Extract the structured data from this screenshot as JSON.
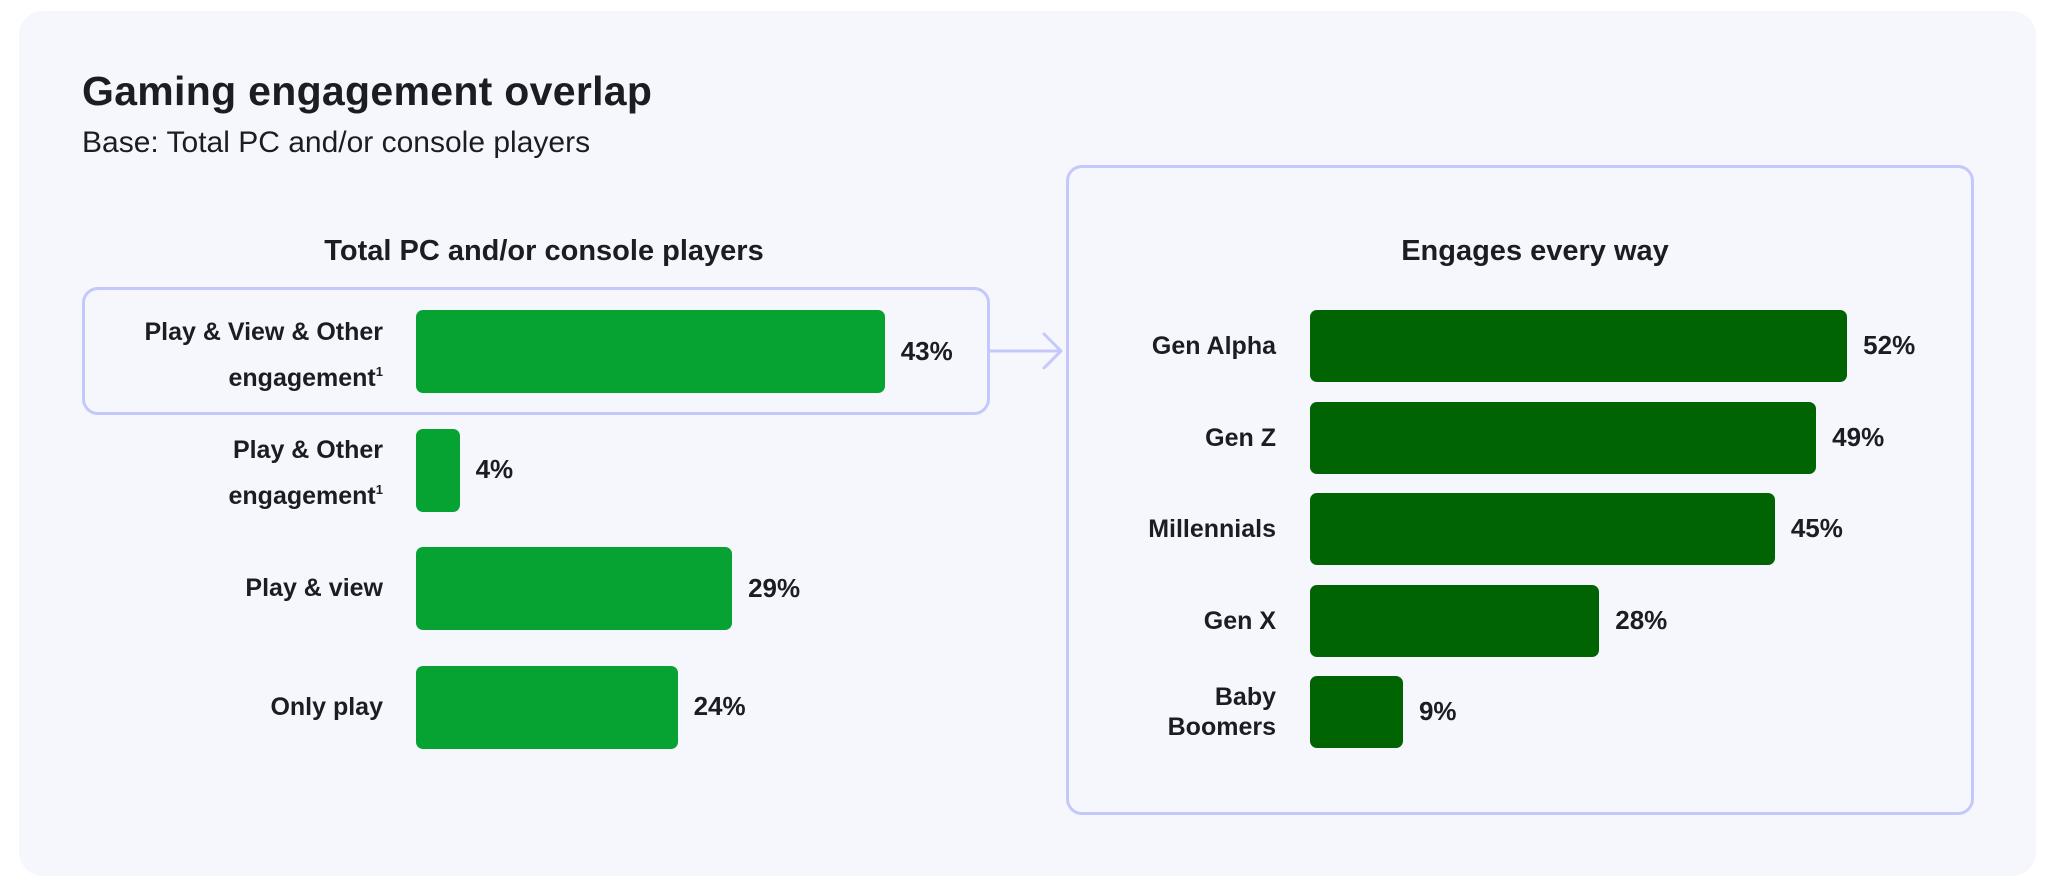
{
  "header": {
    "title": "Gaming engagement overlap",
    "subtitle": "Base: Total PC and/or console players"
  },
  "colors": {
    "background": "#f6f7fd",
    "left_bar": "#07a332",
    "right_bar": "#016402",
    "outline": "#c5c8fb",
    "text": "#1c1d22"
  },
  "icons": {
    "connector": "arrow-right-icon"
  },
  "chart_data": [
    {
      "type": "bar",
      "orientation": "horizontal",
      "title": "Total PC and/or console players",
      "categories": [
        {
          "lines": [
            "Play & View & Other",
            "engagement"
          ],
          "footnote": "1"
        },
        {
          "lines": [
            "Play & Other",
            "engagement"
          ],
          "footnote": "1"
        },
        {
          "lines": [
            "Play & view"
          ],
          "footnote": ""
        },
        {
          "lines": [
            "Only play"
          ],
          "footnote": ""
        }
      ],
      "values": [
        43,
        4,
        29,
        24
      ],
      "value_labels": [
        "43%",
        "4%",
        "29%",
        "24%"
      ],
      "unit": "%",
      "highlighted_category_index": 0,
      "xlabel": "",
      "ylabel": "",
      "xlim": [
        0,
        100
      ],
      "grid": false,
      "legend": "none"
    },
    {
      "type": "bar",
      "orientation": "horizontal",
      "title": "Engages every way",
      "categories": [
        {
          "lines": [
            "Gen Alpha"
          ]
        },
        {
          "lines": [
            "Gen Z"
          ]
        },
        {
          "lines": [
            "Millennials"
          ]
        },
        {
          "lines": [
            "Gen X"
          ]
        },
        {
          "lines": [
            "Baby",
            "Boomers"
          ]
        }
      ],
      "values": [
        52,
        49,
        45,
        28,
        9
      ],
      "value_labels": [
        "52%",
        "49%",
        "45%",
        "28%",
        "9%"
      ],
      "unit": "%",
      "xlabel": "",
      "ylabel": "",
      "xlim": [
        0,
        100
      ],
      "grid": false,
      "legend": "none"
    }
  ]
}
